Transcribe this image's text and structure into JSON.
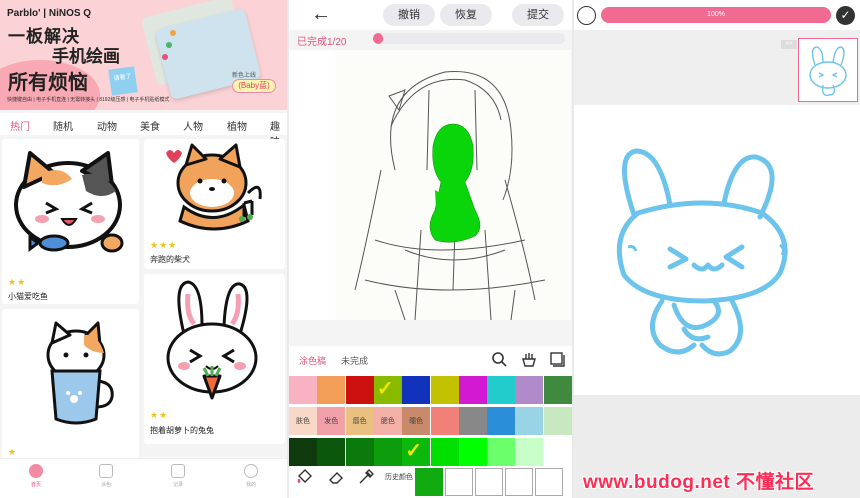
{
  "panel1": {
    "banner": {
      "brand": "Parblo' | NiNOS Q",
      "headline1": "一板解决",
      "headline2": "手机绘画",
      "headline3": "所有烦恼",
      "sticker": "请看了",
      "strip": "快捷键自由 | 电子手机直连 | 无需转接头 | 8192级压感 | 电子手机贴纸模式",
      "new_color": "新色上线",
      "baby": "(Baby蓝)"
    },
    "tabs": [
      "热门",
      "随机",
      "动物",
      "美食",
      "人物",
      "植物",
      "趣味"
    ],
    "cards": [
      {
        "caption": "小猫爱吃鱼",
        "stars": "★★"
      },
      {
        "caption": "奔跑的柴犬",
        "stars": "★★★"
      },
      {
        "caption": "",
        "stars": "★"
      },
      {
        "caption": "抱着胡萝卜的兔兔",
        "stars": "★★"
      }
    ],
    "nav": [
      "首页",
      "涂色",
      "记录",
      "我的"
    ]
  },
  "panel2": {
    "back": "←",
    "undo": "撤销",
    "redo": "恢复",
    "submit": "提交",
    "done_text": "已完成1/20",
    "progress": 0.05,
    "tabs": [
      "涂色稿",
      "未完成"
    ],
    "swatch_labels": [
      "肤色",
      "发色",
      "唇色",
      "腮色",
      "瞳色"
    ],
    "history_label": "历史颜色",
    "colors": {
      "row1": [
        "#f7b3c2",
        "#f29d58",
        "#cc1111",
        "#88bb00",
        "#1133bb",
        "#c2c200",
        "#d11ad1",
        "#22cccc",
        "#b08ac9",
        "#3f8a3f"
      ],
      "row2": [
        "#f8d8c6",
        "#f2a0a8",
        "#e9c080",
        "#f3b0a7",
        "#c88a6a",
        "#f08078",
        "#888888",
        "#2a8ed8",
        "#99d4e6",
        "#c7e8c0"
      ],
      "row3": [
        "#0e3a0e",
        "#0a560a",
        "#0b790b",
        "#0c9c0c",
        "#0db80d",
        "#00e000",
        "#00ff00",
        "#6cff6c",
        "#c8ffc8",
        "#ffffff"
      ]
    }
  },
  "panel3": {
    "progress_label": "100%",
    "progress": 1.0,
    "ref_tab": ">>"
  },
  "watermark": "www.budog.net 不懂社区"
}
